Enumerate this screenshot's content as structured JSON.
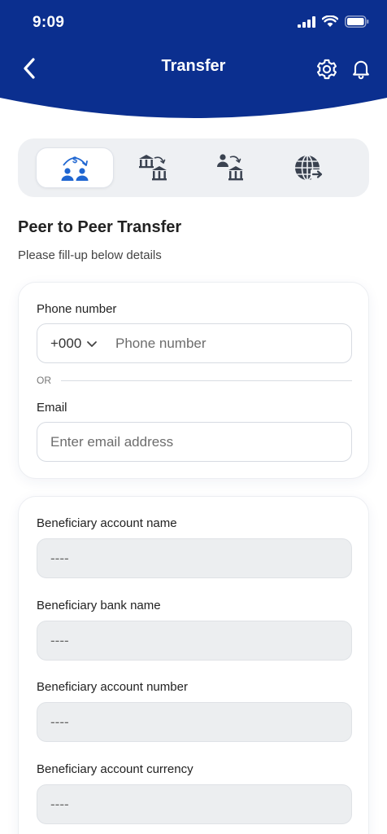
{
  "status_bar": {
    "time": "9:09"
  },
  "header": {
    "title": "Transfer"
  },
  "colors": {
    "header_bg": "#0b2f8f",
    "accent_blue": "#1f66d1",
    "icon_gray": "#3a4250",
    "field_readonly_bg": "#eceef0"
  },
  "tabs": [
    {
      "icon": "peer-transfer-icon",
      "active": true
    },
    {
      "icon": "bank-to-bank-icon",
      "active": false
    },
    {
      "icon": "person-to-bank-icon",
      "active": false
    },
    {
      "icon": "international-transfer-icon",
      "active": false
    }
  ],
  "section": {
    "title": "Peer to Peer Transfer",
    "subtitle": "Please fill-up below details"
  },
  "contact_form": {
    "phone_label": "Phone number",
    "country_code": "+000",
    "phone_placeholder": "Phone number",
    "or_text": "OR",
    "email_label": "Email",
    "email_placeholder": "Enter email address"
  },
  "beneficiary": [
    {
      "label": "Beneficiary account name",
      "value": "----"
    },
    {
      "label": "Beneficiary bank name",
      "value": "----"
    },
    {
      "label": "Beneficiary account number",
      "value": "----"
    },
    {
      "label": "Beneficiary account currency",
      "value": "----"
    }
  ]
}
